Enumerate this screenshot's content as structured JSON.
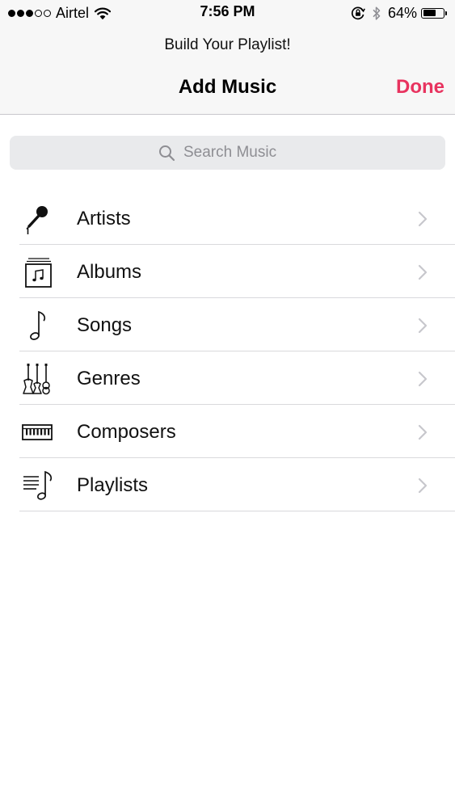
{
  "status_bar": {
    "carrier": "Airtel",
    "time": "7:56 PM",
    "battery_percent": "64%",
    "battery_level": 0.64,
    "signal_filled": 3,
    "signal_total": 5
  },
  "header": {
    "prompt": "Build Your Playlist!",
    "title": "Add Music",
    "done_label": "Done"
  },
  "search": {
    "placeholder": "Search Music"
  },
  "categories": [
    {
      "label": "Artists",
      "icon": "microphone-icon"
    },
    {
      "label": "Albums",
      "icon": "album-icon"
    },
    {
      "label": "Songs",
      "icon": "music-note-icon"
    },
    {
      "label": "Genres",
      "icon": "guitars-icon"
    },
    {
      "label": "Composers",
      "icon": "piano-keyboard-icon"
    },
    {
      "label": "Playlists",
      "icon": "playlist-icon"
    }
  ],
  "colors": {
    "accent": "#e8335f",
    "separator": "#d9d9dc",
    "chevron": "#c7c7cc",
    "search_placeholder": "#8e8e93"
  }
}
